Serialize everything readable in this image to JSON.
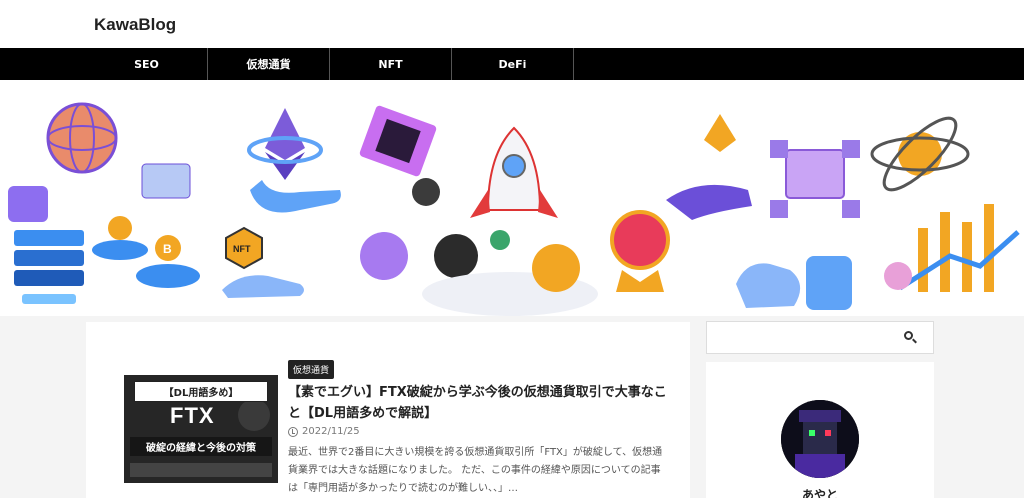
{
  "site": {
    "title": "KawaBlog"
  },
  "nav": {
    "items": [
      "SEO",
      "仮想通貨",
      "NFT",
      "DeFi"
    ]
  },
  "banner": {
    "labels": {
      "nft_badge": "NFT",
      "coin": "B"
    },
    "colors": {
      "purple": "#6b4fd8",
      "gold": "#f2a623",
      "blue": "#3b8ef0",
      "orange": "#f07a2a"
    }
  },
  "post": {
    "category": "仮想通貨",
    "title": "【素でエグい】FTX破綻から学ぶ今後の仮想通貨取引で大事なこと【DL用語多めで解説】",
    "date": "2022/11/25",
    "excerpt": "最近、世界で2番目に大きい規模を誇る仮想通貨取引所「FTX」が破綻して、仮想通貨業界では大きな話題になりました。 ただ、この事件の経緯や原因についての記事は「専門用語が多かったりで読むのが難しい、、」…",
    "thumbnail": {
      "caption": "【DL用語多め】",
      "brand": "FTX",
      "subtitle": "破綻の経緯と今後の対策"
    }
  },
  "sidebar": {
    "search": {
      "placeholder": ""
    },
    "profile": {
      "name": "あやと"
    }
  }
}
